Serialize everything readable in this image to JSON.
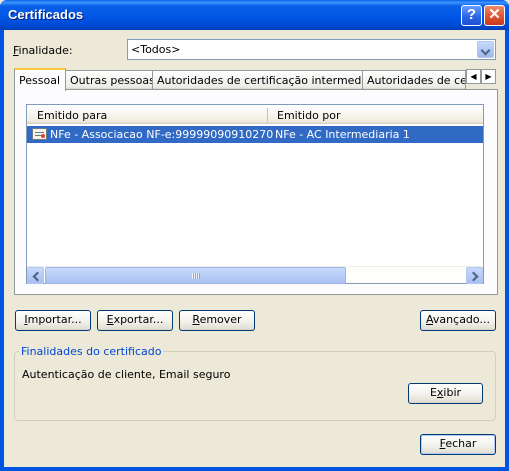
{
  "window": {
    "title": "Certificados",
    "help_label": "?",
    "close_label": "✕"
  },
  "finalidade": {
    "label_prefix": "",
    "label_accel": "F",
    "label_rest": "inalidade:",
    "selected": "<Todos>"
  },
  "tabs": [
    {
      "label": "Pessoal",
      "active": true
    },
    {
      "label": "Outras pessoas",
      "active": false
    },
    {
      "label": "Autoridades de certificação intermediárias",
      "active": false
    },
    {
      "label": "Autoridades de certi",
      "active": false
    }
  ],
  "tab_scroll": {
    "left": "◀",
    "right": "▶"
  },
  "list": {
    "columns": [
      "Emitido para",
      "Emitido por"
    ],
    "rows": [
      {
        "issued_to": "NFe - Associacao NF-e:99999090910270",
        "issued_by": "NFe - AC Intermediaria 1",
        "selected": true
      }
    ]
  },
  "buttons": {
    "import": {
      "accel": "I",
      "rest": "mportar..."
    },
    "export": {
      "accel": "E",
      "rest": "xportar..."
    },
    "remove": {
      "accel": "R",
      "rest": "emover"
    },
    "advanced": {
      "accel": "A",
      "rest": "vançado..."
    },
    "view": {
      "pre": "E",
      "accel": "x",
      "rest": "ibir"
    },
    "close": {
      "accel": "F",
      "rest": "echar"
    }
  },
  "purposes": {
    "title": "Finalidades do certificado",
    "text": "Autenticação de cliente, Email seguro"
  }
}
